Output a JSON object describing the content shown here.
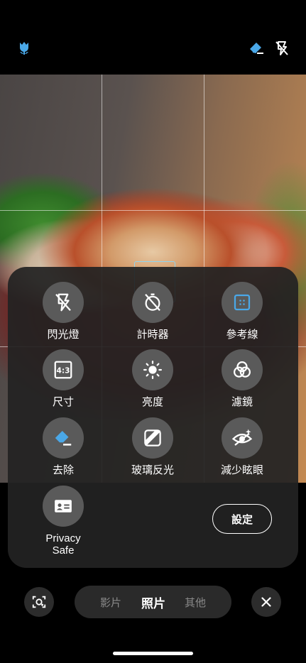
{
  "status_icons": {
    "left": "macro-flower-icon",
    "right": [
      "eraser-icon",
      "flash-off-icon"
    ]
  },
  "colors": {
    "accent": "#4aa8e8",
    "panel": "#222222",
    "option_bg": "#5a5a5a"
  },
  "options": [
    {
      "label": "閃光燈",
      "icon": "flash-off-icon"
    },
    {
      "label": "計時器",
      "icon": "timer-off-icon"
    },
    {
      "label": "參考線",
      "icon": "grid-lines-icon"
    },
    {
      "label": "尺寸",
      "icon": "aspect-ratio-4-3-icon",
      "icon_text": "4:3"
    },
    {
      "label": "亮度",
      "icon": "brightness-icon"
    },
    {
      "label": "濾鏡",
      "icon": "filters-icon"
    },
    {
      "label": "去除",
      "icon": "eraser-icon"
    },
    {
      "label": "玻璃反光",
      "icon": "glass-reflection-icon"
    },
    {
      "label": "減少眩眼",
      "icon": "reduce-glare-icon"
    },
    {
      "label": "Privacy\nSafe",
      "icon": "privacy-id-card-icon"
    }
  ],
  "settings_label": "設定",
  "modes": [
    {
      "label": "影片",
      "active": false
    },
    {
      "label": "照片",
      "active": true
    },
    {
      "label": "其他",
      "active": false
    }
  ],
  "bottom_left_icon": "lens-switch-icon",
  "close_icon": "close-icon"
}
